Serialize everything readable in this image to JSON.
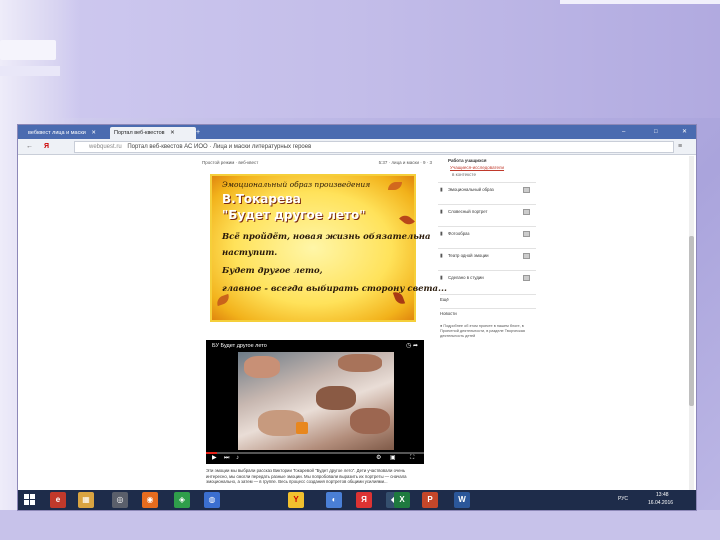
{
  "browser": {
    "tabs": [
      {
        "label": "вебквест лица и маски",
        "active": false
      },
      {
        "label": "Портал веб-квестов",
        "active": true
      }
    ],
    "new_tab_icon": "plus-icon",
    "window_controls": [
      "–",
      "□",
      "✕"
    ],
    "address": {
      "back_icon": "←",
      "yandex": "Я",
      "domain": "webquest.ru",
      "title": "Портал веб-квестов АС ИОО · Лица и маски литературных героев"
    }
  },
  "toolbar": {
    "left": "Простой режим · веб-квест",
    "right": "5:37 · лица и маски · 9 · 3"
  },
  "slide": {
    "heading": "Эмоциональный образ произведения",
    "author": "В.Токарева",
    "title": "\"Будет другое лето\"",
    "quote1": "Всё пройдёт, новая жизнь обязательна",
    "quote2": "наступит.",
    "quote3": "Будет другое лето,",
    "quote4": "главное - всегда выбирать сторону света..."
  },
  "video": {
    "title": "БУ Будет другое лето",
    "progress": 0.05
  },
  "caption": "Эти эмоции мы выбрали рассказ Виктории Токаревой \"Будет другое лето\". Дети участвовали очень интересно, мы смогли передать разные эмоции. Мы попробовали выразить их портреты — сначала эмоционально, а затем — в группе. Весь процесс создания портретов общими усилиями...",
  "sidebar": {
    "title": "Работа учащихся",
    "link": "Учащиеся-исследователи",
    "sub": "в контексте",
    "items": [
      "Эмоциональный образ",
      "Словесный портрет",
      "Фотообраз",
      "Театр одной эмоции",
      "Сделано в студии"
    ],
    "plain": [
      "Ещё",
      "Новости"
    ],
    "note": "● Подробнее об этом проекте в нашем блоге, в Проектной деятельности, в разделе Творческая деятельность детей"
  },
  "taskbar": {
    "apps": [
      "e",
      "▦",
      "◎",
      "◉",
      "◈",
      "◍",
      "Y",
      "◐",
      "Я",
      "◆",
      "X",
      "P",
      "W"
    ],
    "tray_time": "13:48",
    "tray_date": "16.04.2016",
    "tray_lang": "РУС"
  },
  "colors": {
    "taskbar": "#1e2c4a",
    "tabbar": "#4a6bb0",
    "accent_link": "#c0392b",
    "slide_gold": "#ffe25a"
  }
}
